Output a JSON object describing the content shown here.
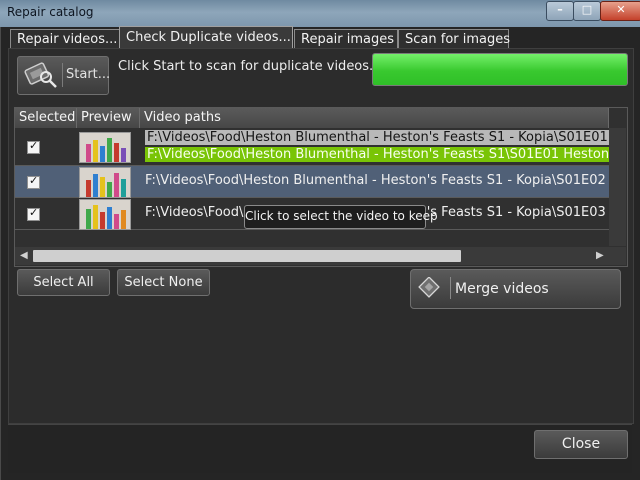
{
  "window": {
    "title": "Repair catalog",
    "minimize_glyph": "–",
    "maximize_glyph": "□",
    "close_glyph": "✕"
  },
  "tabs": [
    {
      "label": "Repair videos...",
      "active": false
    },
    {
      "label": "Check Duplicate videos...",
      "active": true
    },
    {
      "label": "Repair images",
      "active": false
    },
    {
      "label": "Scan for images",
      "active": false
    }
  ],
  "scan": {
    "start_label": "Start...",
    "start_icon": "film-scan-icon",
    "hint": "Click Start to scan for duplicate videos...",
    "progress_fraction": 1.0,
    "progress_color": "#39c92f"
  },
  "grid": {
    "columns": [
      "Selected",
      "Preview",
      "Video paths"
    ],
    "rows": [
      {
        "selected": true,
        "paths": [
          "F:\\Videos\\Food\\Heston Blumenthal - Heston's Feasts S1 - Kopia\\S01E01 H",
          "F:\\Videos\\Food\\Heston Blumenthal - Heston's Feasts S1\\S01E01 Heston's"
        ]
      },
      {
        "selected": true,
        "paths": [
          "F:\\Videos\\Food\\Heston Blumenthal - Heston's Feasts S1 - Kopia\\S01E02 H"
        ]
      },
      {
        "selected": true,
        "paths": [
          "F:\\Videos\\Food\\Heston Blumenthal - Heston's Feasts S1 - Kopia\\S01E03 H"
        ]
      }
    ],
    "tooltip": "Click to select the video to keep",
    "scroll_left": "◀",
    "scroll_right": "▶"
  },
  "actions": {
    "select_all": "Select All",
    "select_none": "Select None",
    "merge": "Merge videos",
    "merge_icon": "merge-film-icon"
  },
  "footer": {
    "close": "Close"
  },
  "colors": {
    "accent_green": "#79c406",
    "selected_row": "#506077"
  }
}
